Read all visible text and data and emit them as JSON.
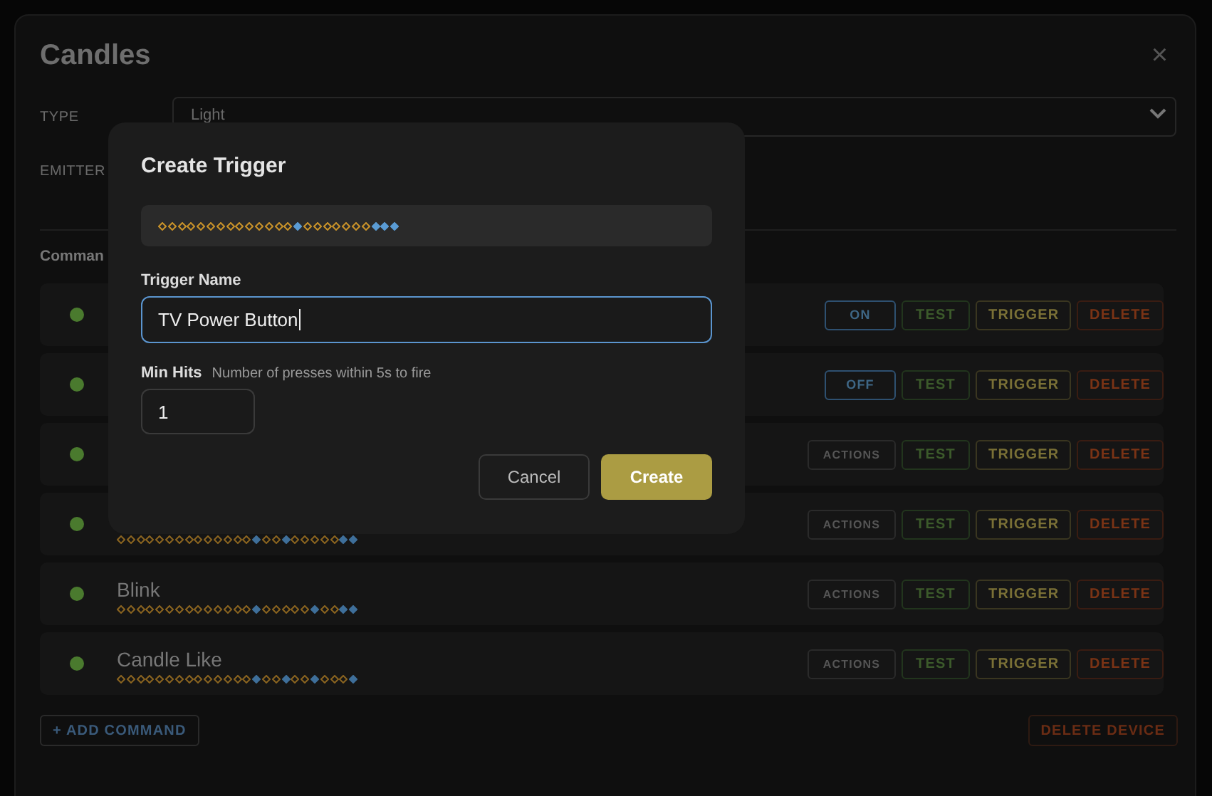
{
  "device": {
    "title": "Candles",
    "close": "×",
    "type_label": "TYPE",
    "type_value": "Light",
    "emitter_label": "EMITTER",
    "commands_label": "Comman",
    "commands": [
      {
        "kind": "toggle",
        "color": "#4a7a2e",
        "mode": "ON",
        "test": "TEST",
        "trigger": "TRIGGER",
        "delete": "DELETE"
      },
      {
        "kind": "toggle",
        "color": "#4a7a2e",
        "mode": "OFF",
        "test": "TEST",
        "trigger": "TRIGGER",
        "delete": "DELETE"
      },
      {
        "kind": "actions",
        "color": "#4a7a2e",
        "mode": "ACTIONS",
        "test": "TEST",
        "trigger": "TRIGGER",
        "delete": "DELETE"
      },
      {
        "kind": "actions",
        "color": "#4a7a2e",
        "bits": [
          false,
          false,
          false,
          false,
          false,
          false,
          false,
          false,
          false,
          false,
          false,
          false,
          false,
          false,
          true,
          false,
          false,
          true,
          false,
          false,
          false,
          false,
          false,
          true,
          true
        ],
        "mode": "ACTIONS",
        "test": "TEST",
        "trigger": "TRIGGER",
        "delete": "DELETE"
      },
      {
        "kind": "actions",
        "color": "#4a7a2e",
        "name": "Blink",
        "bits": [
          false,
          false,
          false,
          false,
          false,
          false,
          false,
          false,
          false,
          false,
          false,
          false,
          false,
          false,
          true,
          false,
          false,
          false,
          false,
          false,
          true,
          false,
          false,
          true,
          true
        ],
        "mode": "ACTIONS",
        "test": "TEST",
        "trigger": "TRIGGER",
        "delete": "DELETE"
      },
      {
        "kind": "actions",
        "color": "#4a7a2e",
        "name": "Candle Like",
        "bits": [
          false,
          false,
          false,
          false,
          false,
          false,
          false,
          false,
          false,
          false,
          false,
          false,
          false,
          false,
          true,
          false,
          false,
          true,
          false,
          false,
          true,
          false,
          false,
          false,
          true
        ],
        "mode": "ACTIONS",
        "test": "TEST",
        "trigger": "TRIGGER",
        "delete": "DELETE"
      }
    ],
    "add_command": "+ ADD COMMAND",
    "delete_device": "DELETE DEVICE"
  },
  "dialog": {
    "title": "Create Trigger",
    "bits": [
      false,
      false,
      false,
      false,
      false,
      false,
      false,
      false,
      false,
      false,
      false,
      false,
      false,
      false,
      true,
      false,
      false,
      false,
      false,
      false,
      false,
      false,
      true,
      true,
      true
    ],
    "name_label": "Trigger Name",
    "name_value": "TV Power Button",
    "hits_label": "Min Hits",
    "hits_hint": "Number of presses within 5s to fire",
    "hits_value": "1",
    "cancel": "Cancel",
    "create": "Create"
  }
}
